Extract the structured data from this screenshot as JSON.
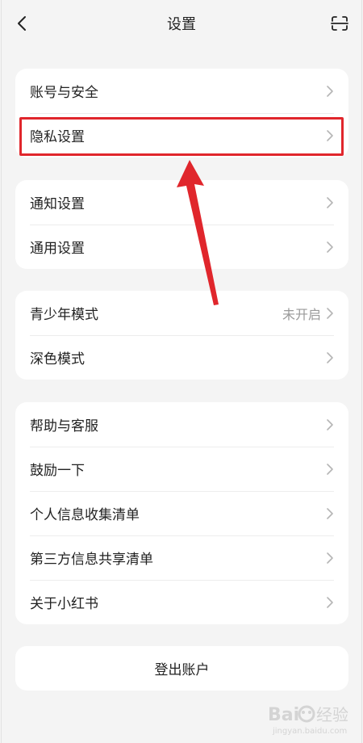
{
  "header": {
    "title": "设置",
    "back_icon": "chevron-left-icon",
    "scan_icon": "scan-icon"
  },
  "groups": [
    {
      "items": [
        {
          "label": "账号与安全"
        },
        {
          "label": "隐私设置"
        }
      ]
    },
    {
      "items": [
        {
          "label": "通知设置"
        },
        {
          "label": "通用设置"
        }
      ]
    },
    {
      "items": [
        {
          "label": "青少年模式",
          "value": "未开启"
        },
        {
          "label": "深色模式"
        }
      ]
    },
    {
      "items": [
        {
          "label": "帮助与客服"
        },
        {
          "label": "鼓励一下"
        },
        {
          "label": "个人信息收集清单"
        },
        {
          "label": "第三方信息共享清单"
        },
        {
          "label": "关于小红书"
        }
      ]
    }
  ],
  "logout": {
    "label": "登出账户"
  },
  "annotation": {
    "highlight_color": "#e0262c",
    "highlighted_item": "隐私设置"
  },
  "watermark": {
    "text": "Bai 经验",
    "subtext": "jingyan.baidu.com"
  }
}
